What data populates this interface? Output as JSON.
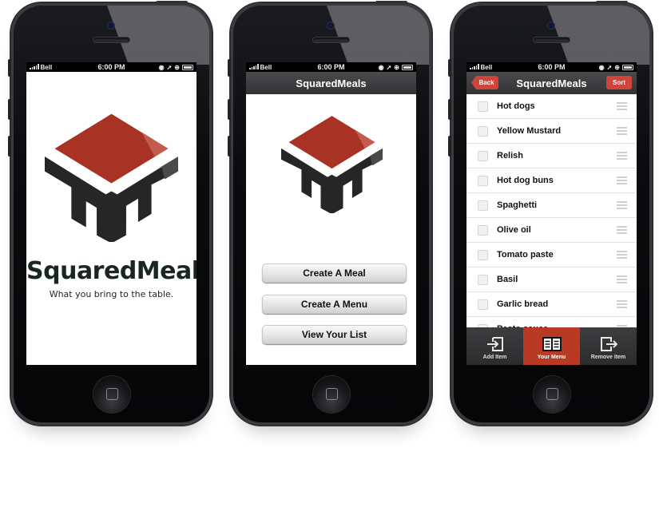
{
  "status_bar": {
    "carrier": "Bell",
    "time": "6:00 PM"
  },
  "colors": {
    "brand_red": "#a83324",
    "dark": "#2b2b2b",
    "nav_button": "#d0443a",
    "active_tab": "#b83a24"
  },
  "splash": {
    "app_name": "SquaredMeals",
    "tagline": "What you bring to the table."
  },
  "home": {
    "title": "SquaredMeals",
    "buttons": [
      {
        "label": "Create A Meal"
      },
      {
        "label": "Create A Menu"
      },
      {
        "label": "View Your List"
      }
    ]
  },
  "list_screen": {
    "title": "SquaredMeals",
    "back_label": "Back",
    "sort_label": "Sort",
    "items": [
      {
        "label": "Hot dogs",
        "checked": false
      },
      {
        "label": "Yellow Mustard",
        "checked": false
      },
      {
        "label": "Relish",
        "checked": false
      },
      {
        "label": "Hot dog buns",
        "checked": false
      },
      {
        "label": "Spaghetti",
        "checked": false
      },
      {
        "label": "Olive oil",
        "checked": false
      },
      {
        "label": "Tomato paste",
        "checked": false
      },
      {
        "label": "Basil",
        "checked": false
      },
      {
        "label": "Garlic bread",
        "checked": false
      },
      {
        "label": "Pesto sauce",
        "checked": false
      }
    ],
    "tabs": [
      {
        "label": "Add Item",
        "icon": "add-item-icon",
        "active": false
      },
      {
        "label": "Your Menu",
        "icon": "menu-book-icon",
        "active": true
      },
      {
        "label": "Remove Item",
        "icon": "remove-item-icon",
        "active": false
      }
    ]
  }
}
